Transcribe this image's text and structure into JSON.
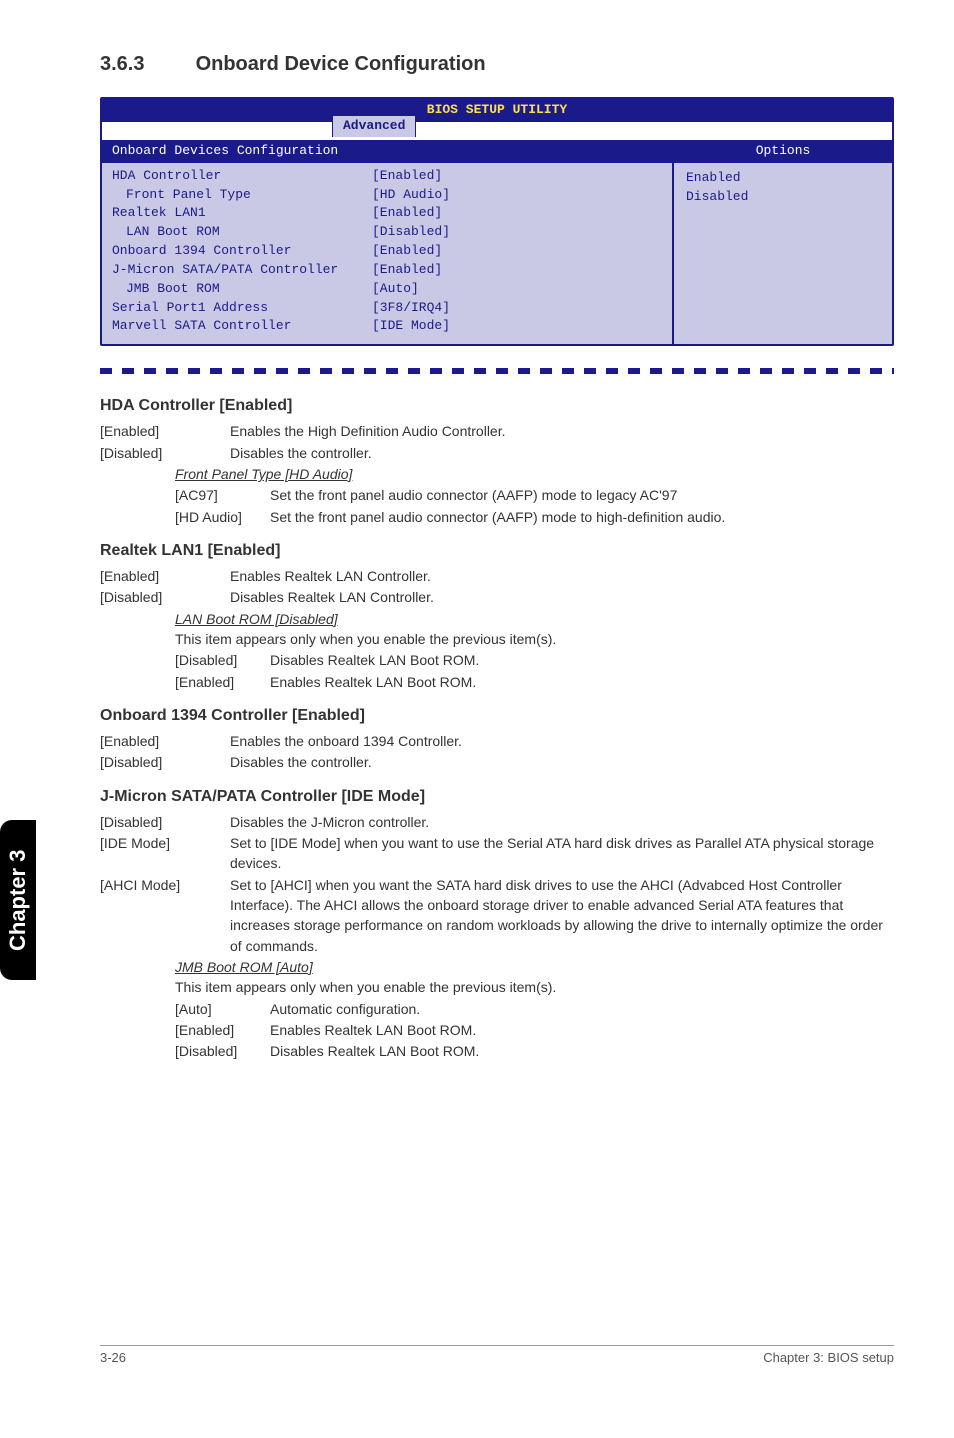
{
  "section": {
    "number": "3.6.3",
    "title": "Onboard Device Configuration"
  },
  "bios": {
    "title": "BIOS SETUP UTILITY",
    "tab": "Advanced",
    "panel_title": "Onboard Devices Configuration",
    "rows": [
      {
        "label": "HDA Controller",
        "value": "[Enabled]",
        "indent": 0
      },
      {
        "label": "Front Panel Type",
        "value": "[HD Audio]",
        "indent": 1
      },
      {
        "label": "Realtek LAN1",
        "value": "[Enabled]",
        "indent": 0
      },
      {
        "label": "LAN Boot ROM",
        "value": "[Disabled]",
        "indent": 1
      },
      {
        "label": "Onboard 1394 Controller",
        "value": "[Enabled]",
        "indent": 0
      },
      {
        "label": "J-Micron SATA/PATA Controller",
        "value": "[Enabled]",
        "indent": 0
      },
      {
        "label": "JMB Boot ROM",
        "value": "[Auto]",
        "indent": 1
      },
      {
        "label": "Serial Port1 Address",
        "value": "[3F8/IRQ4]",
        "indent": 0
      },
      {
        "label": "Marvell SATA Controller",
        "value": "[IDE Mode]",
        "indent": 0
      }
    ],
    "options_title": "Options",
    "options": [
      "Enabled",
      "Disabled"
    ]
  },
  "hda": {
    "heading": "HDA Controller [Enabled]",
    "rows": [
      {
        "k": "[Enabled]",
        "v": "Enables the High Definition Audio Controller."
      },
      {
        "k": "[Disabled]",
        "v": "Disables the controller."
      }
    ],
    "sub_heading": "Front Panel Type [HD Audio]",
    "sub_rows": [
      {
        "k": "[AC97]",
        "v": "Set the front panel audio connector (AAFP) mode to legacy AC'97"
      },
      {
        "k": "[HD Audio]",
        "v": "Set the front panel audio connector (AAFP) mode to high-definition audio."
      }
    ]
  },
  "lan1": {
    "heading": "Realtek LAN1 [Enabled]",
    "rows": [
      {
        "k": "[Enabled]",
        "v": "Enables Realtek LAN Controller."
      },
      {
        "k": "[Disabled]",
        "v": "Disables Realtek LAN Controller."
      }
    ],
    "sub_heading": "LAN Boot ROM [Disabled]",
    "sub_note": "This item appears only when you enable the previous item(s).",
    "sub_rows": [
      {
        "k": "[Disabled]",
        "v": "Disables Realtek LAN Boot ROM."
      },
      {
        "k": "[Enabled]",
        "v": "Enables Realtek LAN Boot ROM."
      }
    ]
  },
  "c1394": {
    "heading": "Onboard 1394 Controller [Enabled]",
    "rows": [
      {
        "k": "[Enabled]",
        "v": "Enables the onboard 1394 Controller."
      },
      {
        "k": "[Disabled]",
        "v": "Disables the controller."
      }
    ]
  },
  "jmicron": {
    "heading": "J-Micron SATA/PATA Controller [IDE Mode]",
    "rows": [
      {
        "k": "[Disabled]",
        "v": "Disables the J-Micron controller."
      },
      {
        "k": "[IDE Mode]",
        "v": "Set to [IDE Mode] when you want to use the Serial ATA hard disk drives as Parallel ATA physical storage devices."
      },
      {
        "k": "[AHCI Mode]",
        "v": "Set to [AHCI] when you want the SATA hard disk drives to use the AHCI (Advabced Host Controller Interface). The AHCI allows the onboard storage driver to enable advanced Serial ATA features that increases storage performance on random workloads by allowing the drive to internally optimize the order of commands."
      }
    ],
    "sub_heading": "JMB Boot ROM [Auto]",
    "sub_note": "This item appears only when you enable the previous item(s).",
    "sub_rows": [
      {
        "k": "[Auto]",
        "v": "Automatic configuration."
      },
      {
        "k": "[Enabled]",
        "v": "Enables Realtek LAN Boot ROM."
      },
      {
        "k": "[Disabled]",
        "v": "Disables Realtek LAN Boot ROM."
      }
    ]
  },
  "sidetab": "Chapter 3",
  "footer": {
    "left": "3-26",
    "right": "Chapter 3: BIOS setup"
  }
}
